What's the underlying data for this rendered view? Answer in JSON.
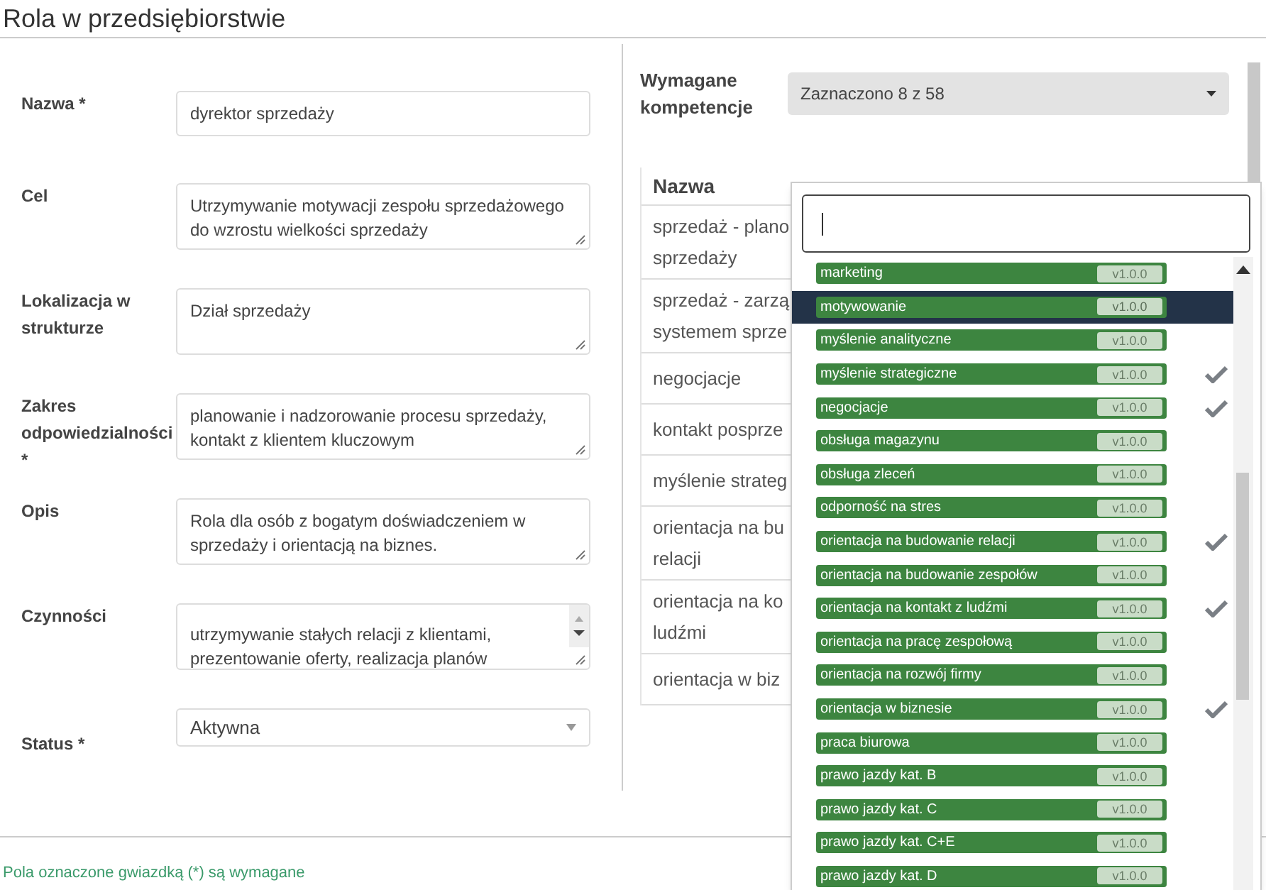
{
  "title": "Rola w przedsiębiorstwie",
  "form": [
    {
      "kind": "input",
      "label": "Nazwa *",
      "value": "dyrektor sprzedaży"
    },
    {
      "kind": "textarea",
      "label": "Cel",
      "value": "Utrzymywanie motywacji zespołu sprzedażowego do wzrostu wielkości sprzedaży"
    },
    {
      "kind": "textarea",
      "label": "Lokalizacja w strukturze",
      "value": "Dział sprzedaży"
    },
    {
      "kind": "textarea",
      "label": "Zakres odpowiedzialności *",
      "value": "planowanie i nadzorowanie procesu sprzedaży, kontakt z klientem kluczowym"
    },
    {
      "kind": "textarea",
      "label": "Opis",
      "value": "Rola dla osób z bogatym doświadczeniem w sprzedaży i orientacją na biznes."
    },
    {
      "kind": "scrolltextarea",
      "label": "Czynności",
      "value": "utrzymywanie stałych relacji z klientami, prezentowanie oferty, realizacja planów"
    },
    {
      "kind": "select",
      "label": "Status *",
      "value": "Aktywna"
    }
  ],
  "competences": {
    "label": "Wymagane kompetencje",
    "summary": "Zaznaczono 8 z 58"
  },
  "table": {
    "columns": [
      "Nazwa"
    ],
    "rows": [
      [
        "sprzedaż - plano",
        "sprzedaży"
      ],
      [
        "sprzedaż - zarzą",
        "systemem sprze"
      ],
      [
        "negocjacje"
      ],
      [
        "kontakt posprze"
      ],
      [
        "myślenie strateg"
      ],
      [
        "orientacja na bu",
        "relacji"
      ],
      [
        "orientacja na ko",
        "ludźmi"
      ],
      [
        "orientacja w biz"
      ]
    ]
  },
  "dropdown": {
    "items": [
      {
        "name": "marketing",
        "version": "v1.0.0",
        "checked": false,
        "highlighted": false
      },
      {
        "name": "motywowanie",
        "version": "v1.0.0",
        "checked": false,
        "highlighted": true
      },
      {
        "name": "myślenie analityczne",
        "version": "v1.0.0",
        "checked": false,
        "highlighted": false
      },
      {
        "name": "myślenie strategiczne",
        "version": "v1.0.0",
        "checked": true,
        "highlighted": false
      },
      {
        "name": "negocjacje",
        "version": "v1.0.0",
        "checked": true,
        "highlighted": false
      },
      {
        "name": "obsługa magazynu",
        "version": "v1.0.0",
        "checked": false,
        "highlighted": false
      },
      {
        "name": "obsługa zleceń",
        "version": "v1.0.0",
        "checked": false,
        "highlighted": false
      },
      {
        "name": "odporność na stres",
        "version": "v1.0.0",
        "checked": false,
        "highlighted": false
      },
      {
        "name": "orientacja na budowanie relacji",
        "version": "v1.0.0",
        "checked": true,
        "highlighted": false
      },
      {
        "name": "orientacja na budowanie zespołów",
        "version": "v1.0.0",
        "checked": false,
        "highlighted": false
      },
      {
        "name": "orientacja na kontakt z ludźmi",
        "version": "v1.0.0",
        "checked": true,
        "highlighted": false
      },
      {
        "name": "orientacja na pracę zespołową",
        "version": "v1.0.0",
        "checked": false,
        "highlighted": false
      },
      {
        "name": "orientacja na rozwój firmy",
        "version": "v1.0.0",
        "checked": false,
        "highlighted": false
      },
      {
        "name": "orientacja w biznesie",
        "version": "v1.0.0",
        "checked": true,
        "highlighted": false
      },
      {
        "name": "praca biurowa",
        "version": "v1.0.0",
        "checked": false,
        "highlighted": false
      },
      {
        "name": "prawo jazdy kat. B",
        "version": "v1.0.0",
        "checked": false,
        "highlighted": false
      },
      {
        "name": "prawo jazdy kat. C",
        "version": "v1.0.0",
        "checked": false,
        "highlighted": false
      },
      {
        "name": "prawo jazdy kat. C+E",
        "version": "v1.0.0",
        "checked": false,
        "highlighted": false
      },
      {
        "name": "prawo jazdy kat. D",
        "version": "v1.0.0",
        "checked": false,
        "highlighted": false
      }
    ]
  },
  "footer": "Pola oznaczone gwiazdką (*) są wymagane"
}
